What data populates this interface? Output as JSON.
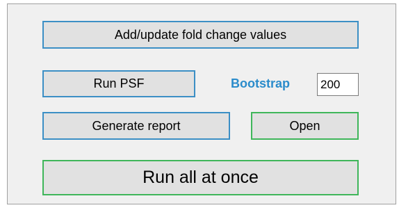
{
  "buttons": {
    "add_update": "Add/update fold change values",
    "run_psf": "Run PSF",
    "generate_report": "Generate report",
    "open": "Open",
    "run_all": "Run all at once"
  },
  "bootstrap": {
    "label": "Bootstrap",
    "value": "200"
  },
  "colors": {
    "blue_border": "#3c8fc5",
    "green_border": "#3fb65a",
    "bootstrap_label": "#2b8ccb",
    "button_bg": "#e1e1e1",
    "panel_bg": "#f0f0f0"
  }
}
